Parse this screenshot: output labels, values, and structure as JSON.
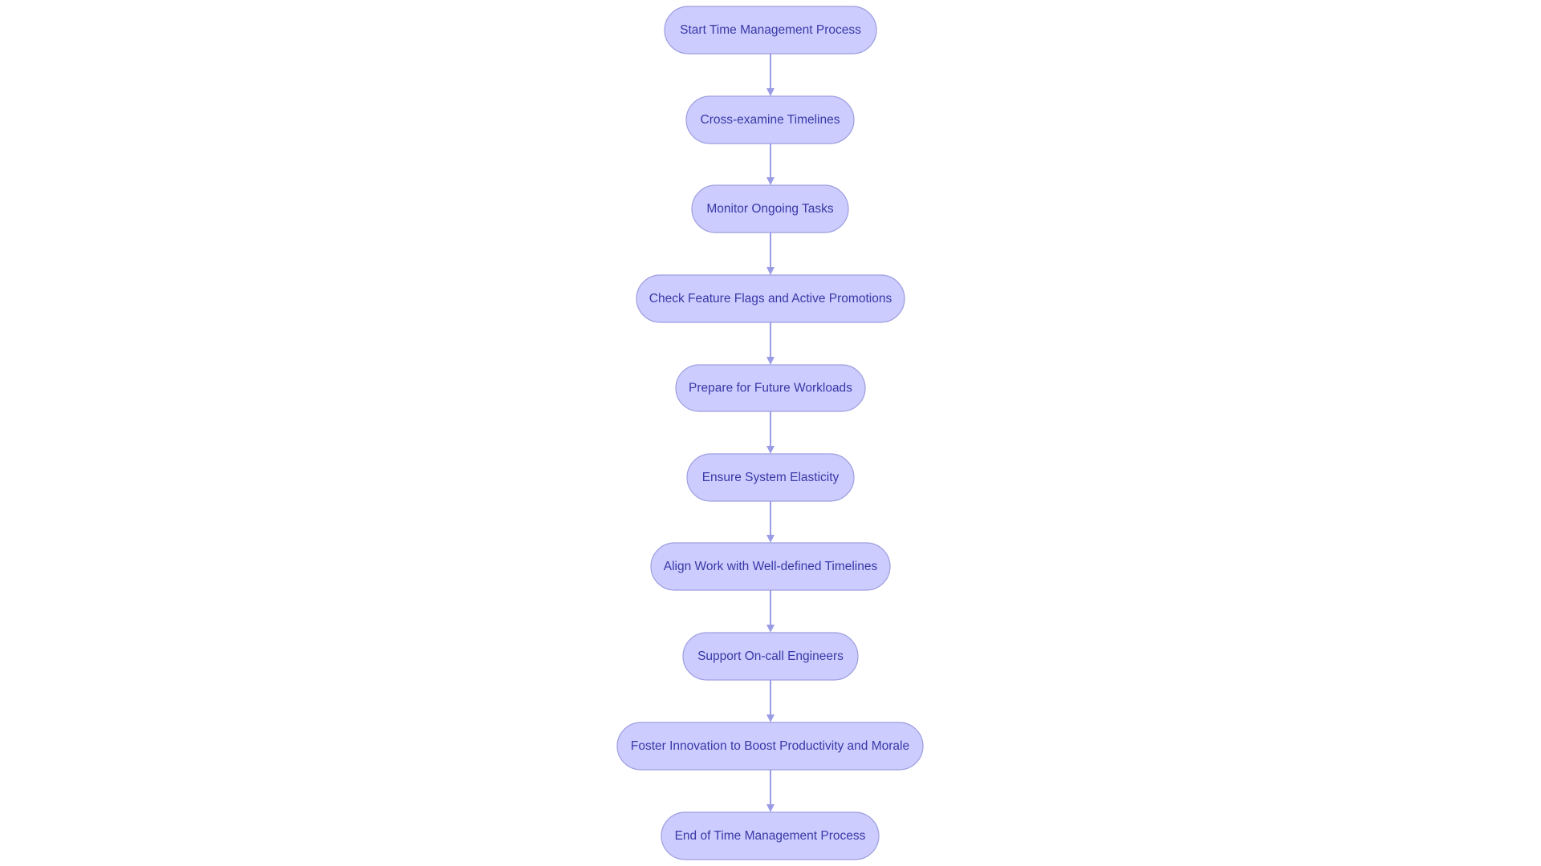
{
  "diagram": {
    "type": "flowchart",
    "direction": "top-to-bottom",
    "colors": {
      "node_fill": "#ccccff",
      "node_border": "#9e9ee0",
      "node_text": "#3939a6",
      "edge": "#9a9de6",
      "background": "#ffffff"
    },
    "nodes": [
      {
        "id": "start",
        "label": "Start Time Management Process"
      },
      {
        "id": "cross",
        "label": "Cross-examine Timelines"
      },
      {
        "id": "monitor",
        "label": "Monitor Ongoing Tasks"
      },
      {
        "id": "flags",
        "label": "Check Feature Flags and Active Promotions"
      },
      {
        "id": "prepare",
        "label": "Prepare for Future Workloads"
      },
      {
        "id": "elastic",
        "label": "Ensure System Elasticity"
      },
      {
        "id": "align",
        "label": "Align Work with Well-defined Timelines"
      },
      {
        "id": "support",
        "label": "Support On-call Engineers"
      },
      {
        "id": "foster",
        "label": "Foster Innovation to Boost Productivity and Morale"
      },
      {
        "id": "end",
        "label": "End of Time Management Process"
      }
    ],
    "edges": [
      {
        "from": "start",
        "to": "cross"
      },
      {
        "from": "cross",
        "to": "monitor"
      },
      {
        "from": "monitor",
        "to": "flags"
      },
      {
        "from": "flags",
        "to": "prepare"
      },
      {
        "from": "prepare",
        "to": "elastic"
      },
      {
        "from": "elastic",
        "to": "align"
      },
      {
        "from": "align",
        "to": "support"
      },
      {
        "from": "support",
        "to": "foster"
      },
      {
        "from": "foster",
        "to": "end"
      }
    ]
  }
}
